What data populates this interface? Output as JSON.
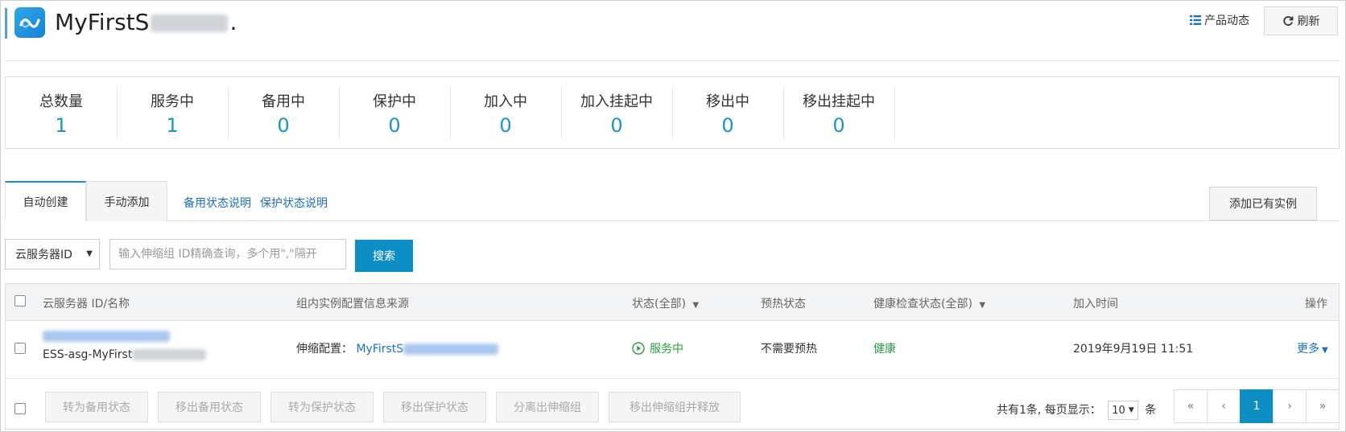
{
  "header": {
    "title_prefix": "MyFirstS",
    "title_suffix": ".",
    "news_label": "产品动态",
    "refresh_label": "刷新"
  },
  "stats": [
    {
      "label": "总数量",
      "value": "1"
    },
    {
      "label": "服务中",
      "value": "1"
    },
    {
      "label": "备用中",
      "value": "0"
    },
    {
      "label": "保护中",
      "value": "0"
    },
    {
      "label": "加入中",
      "value": "0"
    },
    {
      "label": "加入挂起中",
      "value": "0"
    },
    {
      "label": "移出中",
      "value": "0"
    },
    {
      "label": "移出挂起中",
      "value": "0"
    }
  ],
  "tabs": {
    "auto_create": "自动创建",
    "manual_add": "手动添加",
    "standby_help": "备用状态说明",
    "protect_help": "保护状态说明",
    "add_existing": "添加已有实例"
  },
  "search": {
    "select_value": "云服务器ID",
    "placeholder": "输入伸缩组 ID精确查询，多个用\",\"隔开",
    "button": "搜索"
  },
  "table": {
    "columns": {
      "id_name": "云服务器 ID/名称",
      "config_source": "组内实例配置信息来源",
      "status": "状态(全部)",
      "warmup": "预热状态",
      "health": "健康检查状态(全部)",
      "join_time": "加入时间",
      "actions": "操作"
    },
    "rows": [
      {
        "name_prefix": "ESS-asg-MyFirst",
        "config_label": "伸缩配置：",
        "config_link_prefix": "MyFirstS",
        "status": "服务中",
        "warmup": "不需要预热",
        "health": "健康",
        "join_time": "2019年9月19日 11:51",
        "more": "更多"
      }
    ]
  },
  "bulk_actions": [
    "转为备用状态",
    "移出备用状态",
    "转为保护状态",
    "移出保护状态",
    "分离出伸缩组",
    "移出伸缩组并释放"
  ],
  "pagination": {
    "total_text": "共有1条, 每页显示：",
    "page_size": "10",
    "unit": "条",
    "first": "«",
    "prev": "‹",
    "current": "1",
    "next": "›",
    "last": "»"
  },
  "colors": {
    "accent": "#0d8fc6",
    "link": "#1a6fc4",
    "stat_value": "#1a96c8",
    "status_green": "#2a9d3c"
  }
}
